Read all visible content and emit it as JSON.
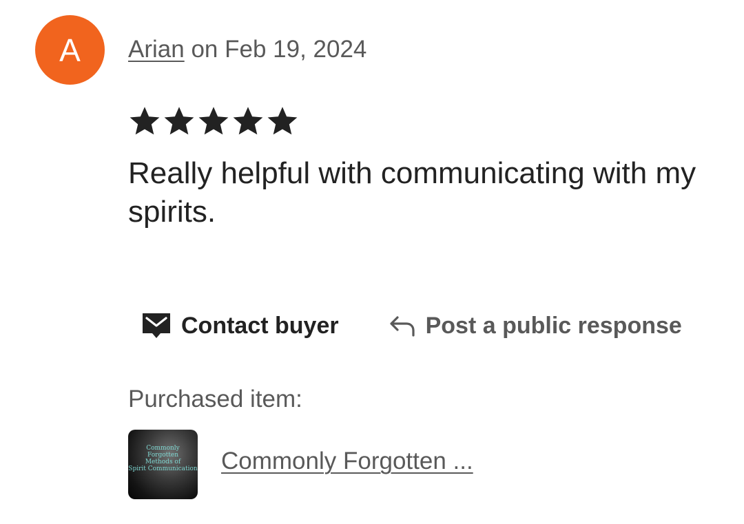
{
  "review": {
    "avatar_letter": "A",
    "avatar_color": "#f1641e",
    "reviewer_name": "Arian",
    "date_prefix": "on",
    "date": "Feb 19, 2024",
    "rating": 5,
    "rating_max": 5,
    "text": "Really helpful with communicating with my spirits."
  },
  "actions": {
    "contact_buyer": {
      "label": "Contact buyer",
      "icon": "envelope-icon"
    },
    "public_response": {
      "label": "Post a public response",
      "icon": "reply-arrow-icon"
    }
  },
  "purchased": {
    "label": "Purchased item:",
    "item_title": "Commonly Forgotten ...",
    "thumbnail_text_lines": [
      "Commonly",
      "Forgotten",
      "Methods of",
      "Spirit Communication"
    ]
  }
}
